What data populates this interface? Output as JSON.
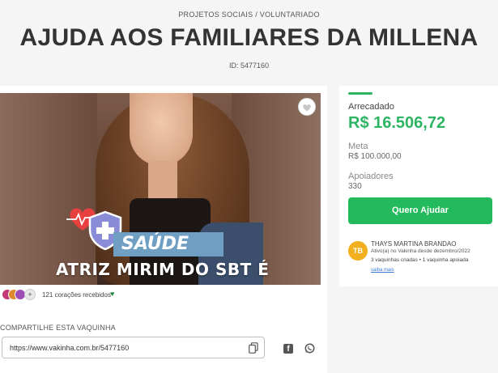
{
  "header": {
    "category": "PROJETOS SOCIAIS / VOLUNTARIADO",
    "title": "AJUDA AOS FAMILIARES DA MILLENA",
    "campaign_id": "ID: 5477160"
  },
  "hero_image": {
    "banner_label": "SAÚDE",
    "caption": "ATRIZ MIRIM DO SBT É",
    "favorite_icon": "heart-icon"
  },
  "engagement": {
    "more_symbol": "+",
    "hearts_text": "121 corações recebidos",
    "heart_icon": "♥",
    "avatar_colors": [
      "#c23b78",
      "#e08a2f",
      "#9d4bb5"
    ]
  },
  "share": {
    "label": "COMPARTILHE ESTA VAQUINHA",
    "url": "https://www.vakinha.com.br/5477160",
    "facebook_letter": "f"
  },
  "stats": {
    "raised_label": "Arrecadado",
    "raised_value": "R$ 16.506,72",
    "goal_label": "Meta",
    "goal_value": "R$ 100.000,00",
    "supporters_label": "Apoiadores",
    "supporters_value": "330",
    "help_button": "Quero Ajudar"
  },
  "creator": {
    "initials": "TB",
    "name": "THAYS MARTINA BRANDAO",
    "since": "Ativo(a) no Vakinha desde dezembro/2022",
    "stats": "3 vaquinhas criadas  •  1 vaquinha apoiada",
    "link": "saiba mais"
  },
  "colors": {
    "accent_green": "#23b95d",
    "amount_green": "#2db564",
    "creator_avatar": "#f2b01e"
  }
}
